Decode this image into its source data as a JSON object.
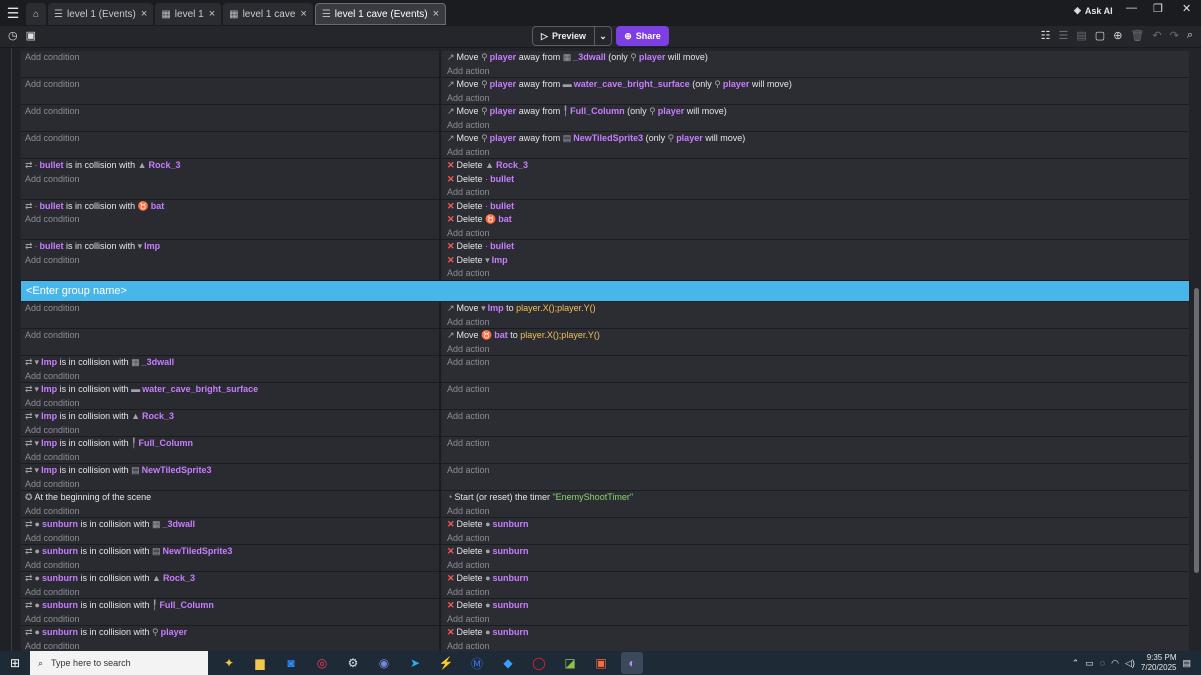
{
  "tabs": [
    {
      "label": "level 1 (Events)",
      "icon": "events-icon",
      "active": false
    },
    {
      "label": "level 1",
      "icon": "scene-icon",
      "active": false
    },
    {
      "label": "level 1 cave",
      "icon": "scene-icon",
      "active": false
    },
    {
      "label": "level 1 cave (Events)",
      "icon": "events-icon",
      "active": true
    }
  ],
  "header": {
    "ask_ai": "Ask AI",
    "preview": "Preview",
    "share": "Share"
  },
  "events_top": [
    {
      "cond": [],
      "acts": [
        [
          [
            "t",
            "Move "
          ],
          [
            "o",
            "player"
          ],
          [
            "t",
            " away from "
          ],
          [
            "o",
            "_3dwall"
          ],
          [
            "t",
            " (only "
          ],
          [
            "o",
            "player"
          ],
          [
            "t",
            " will move)"
          ]
        ]
      ]
    },
    {
      "cond": [],
      "acts": [
        [
          [
            "t",
            "Move "
          ],
          [
            "o",
            "player"
          ],
          [
            "t",
            " away from "
          ],
          [
            "o",
            "water_cave_bright_surface"
          ],
          [
            "t",
            " (only "
          ],
          [
            "o",
            "player"
          ],
          [
            "t",
            " will move)"
          ]
        ]
      ]
    },
    {
      "cond": [],
      "acts": [
        [
          [
            "t",
            "Move "
          ],
          [
            "o",
            "player"
          ],
          [
            "t",
            " away from "
          ],
          [
            "o",
            "Full_Column"
          ],
          [
            "t",
            " (only "
          ],
          [
            "o",
            "player"
          ],
          [
            "t",
            " will move)"
          ]
        ]
      ]
    },
    {
      "cond": [],
      "acts": [
        [
          [
            "t",
            "Move "
          ],
          [
            "o",
            "player"
          ],
          [
            "t",
            " away from "
          ],
          [
            "o",
            "NewTiledSprite3"
          ],
          [
            "t",
            " (only "
          ],
          [
            "o",
            "player"
          ],
          [
            "t",
            " will move)"
          ]
        ]
      ]
    },
    {
      "cond": [
        [
          [
            "o",
            "bullet"
          ],
          [
            "t",
            " is in collision with "
          ],
          [
            "o",
            "Rock_3"
          ]
        ]
      ],
      "acts": [
        [
          [
            "d",
            ""
          ],
          [
            "t",
            "Delete "
          ],
          [
            "o",
            "Rock_3"
          ]
        ],
        [
          [
            "d",
            ""
          ],
          [
            "t",
            "Delete "
          ],
          [
            "o",
            "bullet"
          ]
        ]
      ]
    },
    {
      "cond": [
        [
          [
            "o",
            "bullet"
          ],
          [
            "t",
            " is in collision with "
          ],
          [
            "o",
            "bat"
          ]
        ]
      ],
      "acts": [
        [
          [
            "d",
            ""
          ],
          [
            "t",
            "Delete "
          ],
          [
            "o",
            "bullet"
          ]
        ],
        [
          [
            "d",
            ""
          ],
          [
            "t",
            "Delete "
          ],
          [
            "o",
            "bat"
          ]
        ]
      ]
    },
    {
      "cond": [
        [
          [
            "o",
            "bullet"
          ],
          [
            "t",
            " is in collision with "
          ],
          [
            "o",
            "Imp"
          ]
        ]
      ],
      "acts": [
        [
          [
            "d",
            ""
          ],
          [
            "t",
            "Delete "
          ],
          [
            "o",
            "bullet"
          ]
        ],
        [
          [
            "d",
            ""
          ],
          [
            "t",
            "Delete "
          ],
          [
            "o",
            "Imp"
          ]
        ]
      ]
    }
  ],
  "group_name": "<Enter group name>",
  "events_bottom": [
    {
      "cond": [],
      "acts": [
        [
          [
            "t",
            "Move "
          ],
          [
            "o",
            "Imp"
          ],
          [
            "t",
            " to "
          ],
          [
            "e",
            "player.X();player.Y()"
          ]
        ]
      ]
    },
    {
      "cond": [],
      "acts": [
        [
          [
            "t",
            "Move "
          ],
          [
            "o",
            "bat"
          ],
          [
            "t",
            " to "
          ],
          [
            "e",
            "player.X();player.Y()"
          ]
        ]
      ]
    },
    {
      "cond": [
        [
          [
            "o",
            "Imp"
          ],
          [
            "t",
            " is in collision with "
          ],
          [
            "o",
            "_3dwall"
          ]
        ]
      ],
      "acts": []
    },
    {
      "cond": [
        [
          [
            "o",
            "Imp"
          ],
          [
            "t",
            " is in collision with "
          ],
          [
            "o",
            "water_cave_bright_surface"
          ]
        ]
      ],
      "acts": []
    },
    {
      "cond": [
        [
          [
            "o",
            "Imp"
          ],
          [
            "t",
            " is in collision with "
          ],
          [
            "o",
            "Rock_3"
          ]
        ]
      ],
      "acts": []
    },
    {
      "cond": [
        [
          [
            "o",
            "Imp"
          ],
          [
            "t",
            " is in collision with "
          ],
          [
            "o",
            "Full_Column"
          ]
        ]
      ],
      "acts": []
    },
    {
      "cond": [
        [
          [
            "o",
            "Imp"
          ],
          [
            "t",
            " is in collision with "
          ],
          [
            "o",
            "NewTiledSprite3"
          ]
        ]
      ],
      "acts": []
    },
    {
      "cond": [
        [
          [
            "t",
            "At the beginning of the scene"
          ]
        ]
      ],
      "acts": [
        [
          [
            "t",
            "Start (or reset) the timer "
          ],
          [
            "s",
            "\"EnemyShootTimer\""
          ]
        ]
      ]
    },
    {
      "cond": [
        [
          [
            "o",
            "sunburn"
          ],
          [
            "t",
            " is in collision with "
          ],
          [
            "o",
            "_3dwall"
          ]
        ]
      ],
      "acts": [
        [
          [
            "d",
            ""
          ],
          [
            "t",
            "Delete "
          ],
          [
            "o",
            "sunburn"
          ]
        ]
      ]
    },
    {
      "cond": [
        [
          [
            "o",
            "sunburn"
          ],
          [
            "t",
            " is in collision with "
          ],
          [
            "o",
            "NewTiledSprite3"
          ]
        ]
      ],
      "acts": [
        [
          [
            "d",
            ""
          ],
          [
            "t",
            "Delete "
          ],
          [
            "o",
            "sunburn"
          ]
        ]
      ]
    },
    {
      "cond": [
        [
          [
            "o",
            "sunburn"
          ],
          [
            "t",
            " is in collision with "
          ],
          [
            "o",
            "Rock_3"
          ]
        ]
      ],
      "acts": [
        [
          [
            "d",
            ""
          ],
          [
            "t",
            "Delete "
          ],
          [
            "o",
            "sunburn"
          ]
        ]
      ]
    },
    {
      "cond": [
        [
          [
            "o",
            "sunburn"
          ],
          [
            "t",
            " is in collision with "
          ],
          [
            "o",
            "Full_Column"
          ]
        ]
      ],
      "acts": [
        [
          [
            "d",
            ""
          ],
          [
            "t",
            "Delete "
          ],
          [
            "o",
            "sunburn"
          ]
        ]
      ]
    },
    {
      "cond": [
        [
          [
            "o",
            "sunburn"
          ],
          [
            "t",
            " is in collision with "
          ],
          [
            "o",
            "player"
          ]
        ]
      ],
      "acts": [
        [
          [
            "d",
            ""
          ],
          [
            "t",
            "Delete "
          ],
          [
            "o",
            "sunburn"
          ]
        ]
      ]
    }
  ],
  "labels": {
    "add_condition": "Add condition",
    "add_action": "Add action"
  },
  "taskbar": {
    "search_placeholder": "Type here to search",
    "time": "9:35 PM",
    "date": "7/20/2025"
  },
  "colors": {
    "object": "#c77dff",
    "string": "#88d66b",
    "expression": "#f0c25a",
    "group_bar": "#49b6ea",
    "share_button": "#7b3fe4",
    "delete": "#ff5a5a"
  }
}
